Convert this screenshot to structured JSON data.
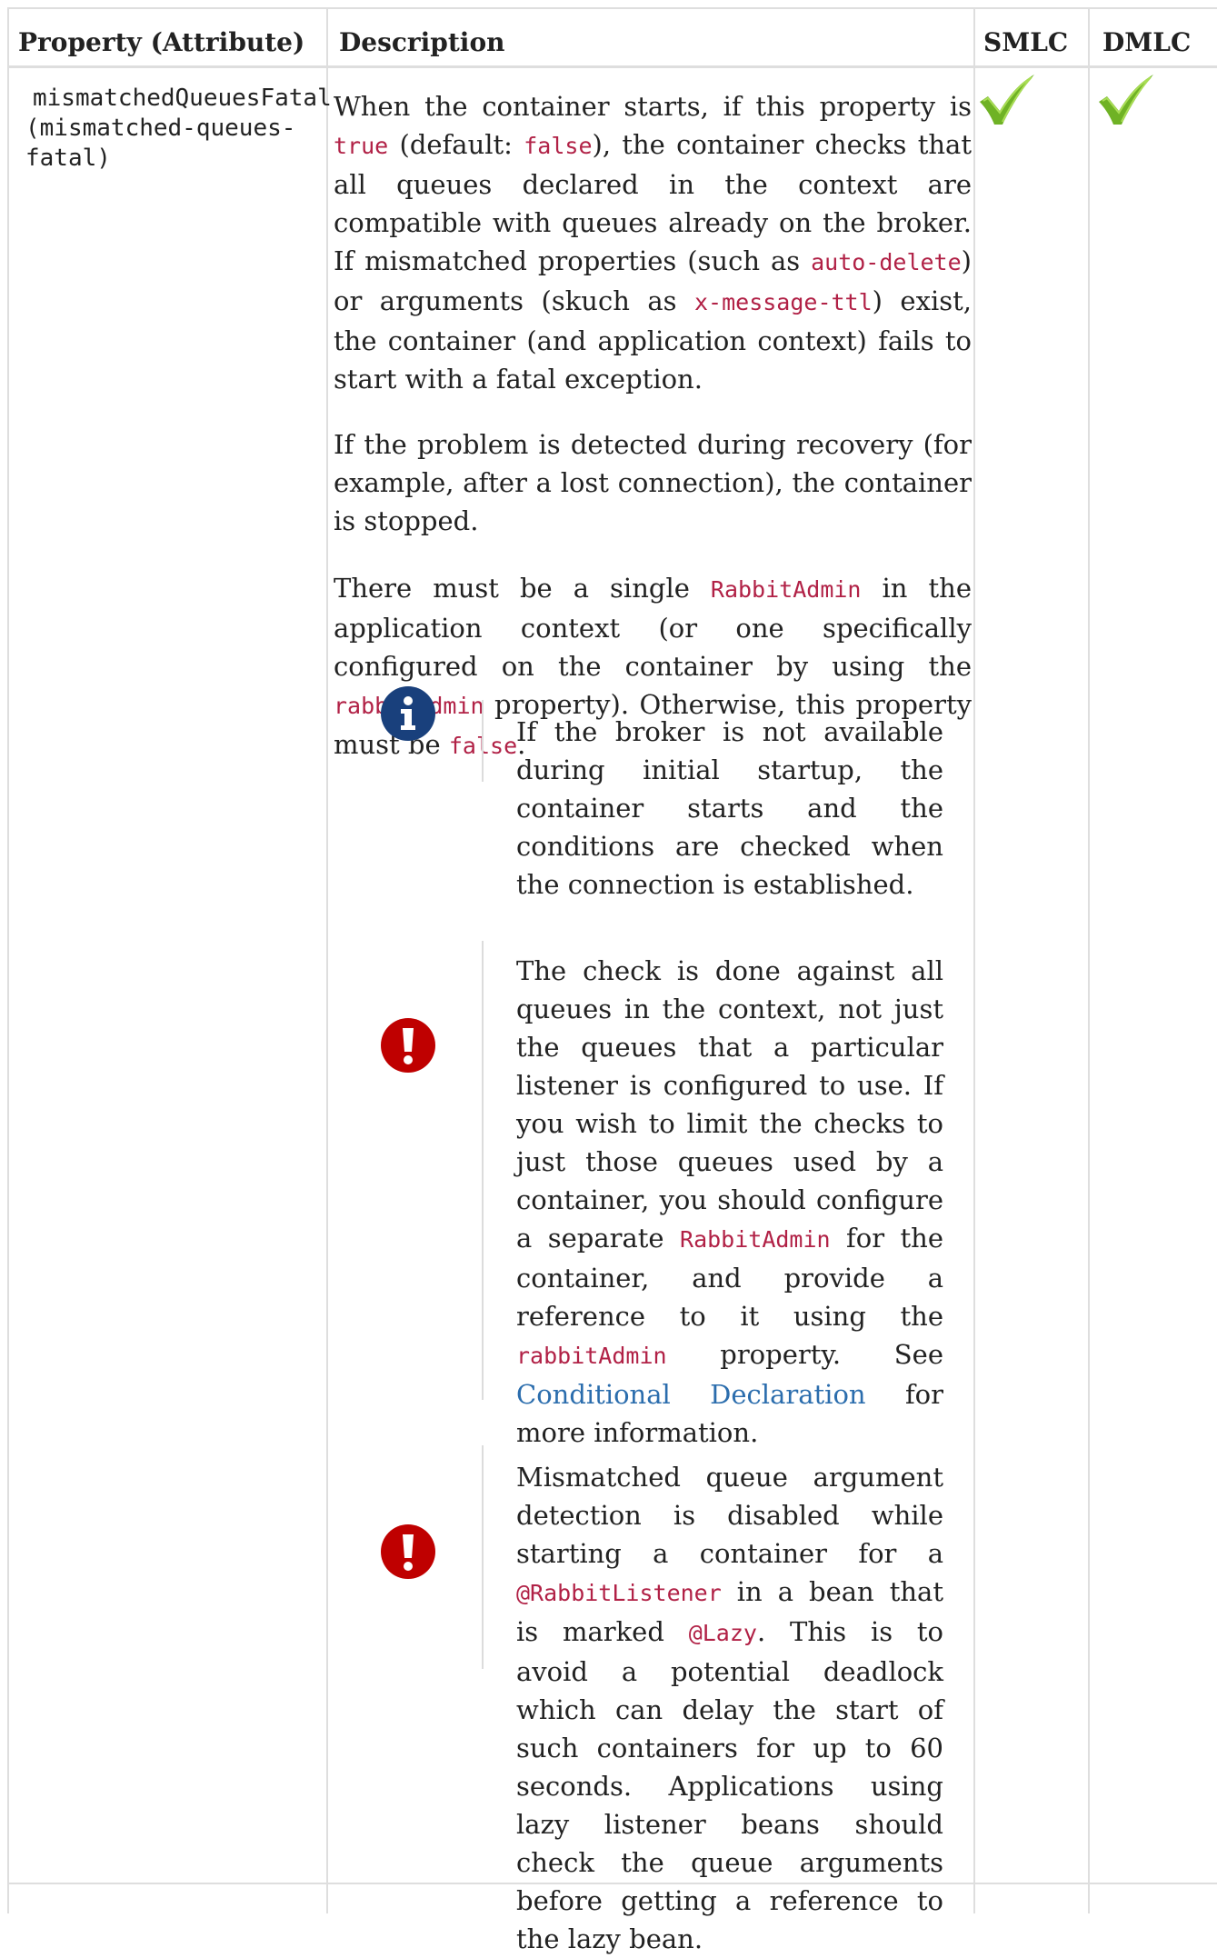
{
  "table": {
    "headers": {
      "property": "Property (Attribute)",
      "description": "Description",
      "smlc": "SMLC",
      "dmlc": "DMLC"
    },
    "row": {
      "property_name": "mismatchedQueuesFatal",
      "attribute_line1": "(mismatched-queues-",
      "attribute_line2": "fatal)",
      "para1": {
        "t1": "When the container starts, if this property is ",
        "c1": "true",
        "t2": " (default: ",
        "c2": "false",
        "t3": "), the container checks that all queues declared in the context are compatible with queues already on the broker. If mismatched properties (such as ",
        "c3": "auto-delete",
        "t4": ") or arguments (skuch as ",
        "c4": "x-message-ttl",
        "t5": ") exist, the container (and application context) fails to start with a fatal exception."
      },
      "para2": "If the problem is detected during recovery (for example, after a lost connection), the container is stopped.",
      "para3": {
        "t1": "There must be a single ",
        "c1": "RabbitAdmin",
        "t2": " in the application context (or one specifically configured on the container by using the ",
        "c2": "rabbitAdmin",
        "t3": " property). Otherwise, this property must be ",
        "c3": "false",
        "t4": "."
      },
      "note": "If the broker is not available during initial startup, the container starts and the conditions are checked when the connection is established.",
      "important1": {
        "t1": "The check is done against all queues in the context, not just the queues that a particular listener is configured to use. If you wish to limit the checks to just those queues used by a container, you should configure a separate ",
        "c1": "RabbitAdmin",
        "t2": " for the container, and provide a reference to it using the ",
        "c2": "rabbitAdmin",
        "t3": " property. See ",
        "link": "Conditional Declaration",
        "t4": " for more information."
      },
      "important2": {
        "t1": "Mismatched queue argument detection is disabled while starting a container for a ",
        "c1": "@RabbitListener",
        "t2": " in a bean that is marked ",
        "c2": "@Lazy",
        "t3": ". This is to avoid a potential deadlock which can delay the start of such containers for up to 60 seconds. Applications using lazy listener beans should check the queue arguments before getting a reference to the lazy bean."
      },
      "smlc_supported": true,
      "dmlc_supported": true
    }
  },
  "icons": {
    "note": "info-icon",
    "important": "exclamation-icon",
    "check": "checkmark-icon"
  },
  "colors": {
    "code": "#b12146",
    "link": "#2b6dad",
    "info": "#19407c",
    "warning": "#bf0000",
    "check": "#6fb225",
    "border": "#dedede"
  }
}
